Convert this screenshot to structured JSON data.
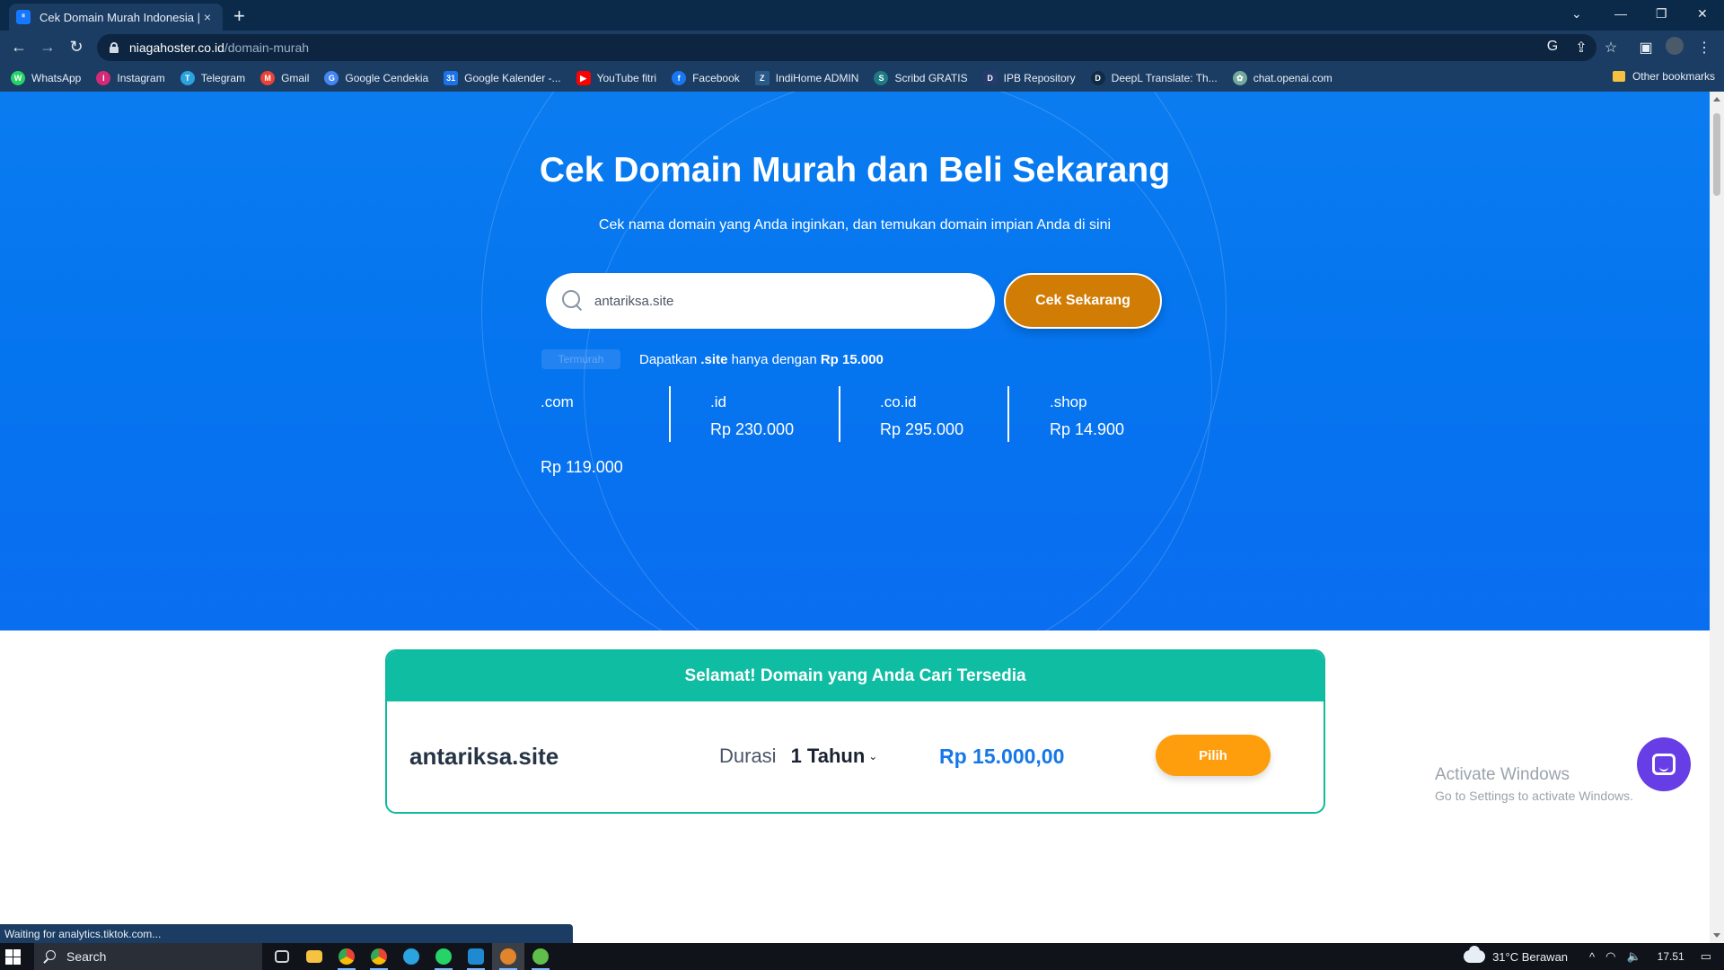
{
  "browser": {
    "tab": {
      "favicon": "niagahoster-logo-icon",
      "title": "Cek Domain Murah Indonesia | B",
      "close": "×"
    },
    "new_tab": "+",
    "window_controls": {
      "tab_search": "⌄",
      "minimize": "—",
      "restore": "❐",
      "close": "✕"
    },
    "nav": {
      "back": "←",
      "forward": "→",
      "reload": "↻"
    },
    "address": {
      "host": "niagahoster.co.id",
      "path": "/domain-murah"
    },
    "toolbar_icons": {
      "google": "G",
      "share": "⇪",
      "star": "☆",
      "sidepanel": "▣",
      "menu": "⋮"
    },
    "bookmarks": [
      {
        "label": "WhatsApp",
        "icon": "whatsapp-icon",
        "color": "#25d366",
        "glyph": "W"
      },
      {
        "label": "Instagram",
        "icon": "instagram-icon",
        "color": "#d62976",
        "glyph": "I"
      },
      {
        "label": "Telegram",
        "icon": "telegram-icon",
        "color": "#2aa3df",
        "glyph": "T"
      },
      {
        "label": "Gmail",
        "icon": "gmail-icon",
        "color": "#ea4335",
        "glyph": "M"
      },
      {
        "label": "Google Cendekia",
        "icon": "google-scholar-icon",
        "color": "#4285f4",
        "glyph": "G"
      },
      {
        "label": "Google Kalender -...",
        "icon": "google-calendar-icon",
        "color": "#1a73e8",
        "glyph": "31"
      },
      {
        "label": "YouTube fitri",
        "icon": "youtube-icon",
        "color": "#ff0000",
        "glyph": "▶"
      },
      {
        "label": "Facebook",
        "icon": "facebook-icon",
        "color": "#1877f2",
        "glyph": "f"
      },
      {
        "label": "IndiHome ADMIN",
        "icon": "zte-icon",
        "color": "#2a5a8a",
        "glyph": "Z"
      },
      {
        "label": "Scribd GRATIS",
        "icon": "scribd-icon",
        "color": "#1e7b85",
        "glyph": "S"
      },
      {
        "label": "IPB Repository",
        "icon": "ipb-icon",
        "color": "#243b6b",
        "glyph": "D"
      },
      {
        "label": "DeepL Translate: Th...",
        "icon": "deepl-icon",
        "color": "#0f2b46",
        "glyph": "D"
      },
      {
        "label": "chat.openai.com",
        "icon": "openai-icon",
        "color": "#74aa9c",
        "glyph": "✿"
      }
    ],
    "other_bookmarks": "Other bookmarks",
    "status": "Waiting for analytics.tiktok.com..."
  },
  "hero": {
    "title": "Cek Domain Murah dan Beli Sekarang",
    "subtitle": "Cek nama domain yang Anda inginkan, dan temukan domain impian Anda di sini",
    "search": {
      "value": "antariksa.site",
      "placeholder": ""
    },
    "button": "Cek Sekarang",
    "badge": "Termurah",
    "promo": {
      "prefix": "Dapatkan",
      "tld": ".site",
      "middle": "hanya dengan",
      "price": "Rp 15.000"
    },
    "tlds": [
      {
        "name": ".com",
        "price": "Rp 119.000"
      },
      {
        "name": ".id",
        "price": "Rp 230.000"
      },
      {
        "name": ".co.id",
        "price": "Rp 295.000"
      },
      {
        "name": ".shop",
        "price": "Rp 14.900"
      }
    ]
  },
  "result": {
    "header": "Selamat! Domain yang Anda Cari Tersedia",
    "domain": "antariksa.site",
    "duration_label": "Durasi",
    "duration_value": "1 Tahun",
    "price": "Rp 15.000,00",
    "button": "Pilih"
  },
  "watermark": {
    "line1": "Activate Windows",
    "line2": "Go to Settings to activate Windows."
  },
  "taskbar": {
    "search": "Search",
    "apps": [
      {
        "name": "task-view-icon",
        "color": "#d0d5dc"
      },
      {
        "name": "file-explorer-icon",
        "color": "#f5c242"
      },
      {
        "name": "chrome-icon",
        "color": "#4caf50"
      },
      {
        "name": "chrome-icon-2",
        "color": "#e04b3b"
      },
      {
        "name": "telegram-icon",
        "color": "#2aa3df"
      },
      {
        "name": "whatsapp-icon",
        "color": "#25d366"
      },
      {
        "name": "vscode-icon",
        "color": "#1f8ad2"
      },
      {
        "name": "app-orange-icon",
        "color": "#e0852b"
      },
      {
        "name": "app-green-icon",
        "color": "#5fbf4a"
      }
    ],
    "weather": "31°C  Berawan",
    "tray": {
      "chevron": "^",
      "wifi": "◠",
      "volume": "🔈",
      "time": "17.51",
      "notification": "▭"
    }
  }
}
